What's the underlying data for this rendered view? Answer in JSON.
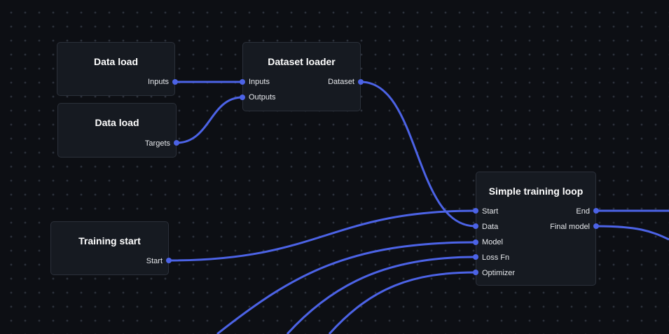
{
  "canvas": {
    "wire_color": "#4c63e6",
    "node_background": "#161a21",
    "node_border": "#2b303a",
    "background": "#0d0f14"
  },
  "nodes": {
    "data_load_inputs": {
      "title": "Data load",
      "outputs": [
        "Inputs"
      ]
    },
    "data_load_targets": {
      "title": "Data load",
      "outputs": [
        "Targets"
      ]
    },
    "dataset_loader": {
      "title": "Dataset loader",
      "inputs": [
        "Inputs",
        "Outputs"
      ],
      "outputs": [
        "Dataset"
      ]
    },
    "training_start": {
      "title": "Training start",
      "outputs": [
        "Start"
      ]
    },
    "simple_training_loop": {
      "title": "Simple training loop",
      "inputs": [
        "Start",
        "Data",
        "Model",
        "Loss Fn",
        "Optimizer"
      ],
      "outputs": [
        "End",
        "Final model"
      ]
    }
  },
  "connections": [
    {
      "from": "Data load.Inputs",
      "to": "Dataset loader.Inputs"
    },
    {
      "from": "Data load.Targets",
      "to": "Dataset loader.Outputs"
    },
    {
      "from": "Dataset loader.Dataset",
      "to": "Simple training loop.Data"
    },
    {
      "from": "Training start.Start",
      "to": "Simple training loop.Start"
    },
    {
      "from": "Simple training loop.End",
      "to": "off-screen"
    },
    {
      "from": "Simple training loop.Final model",
      "to": "off-screen"
    },
    {
      "from": "off-screen",
      "to": "Simple training loop.Model"
    },
    {
      "from": "off-screen",
      "to": "Simple training loop.Loss Fn"
    },
    {
      "from": "off-screen",
      "to": "Simple training loop.Optimizer"
    }
  ]
}
